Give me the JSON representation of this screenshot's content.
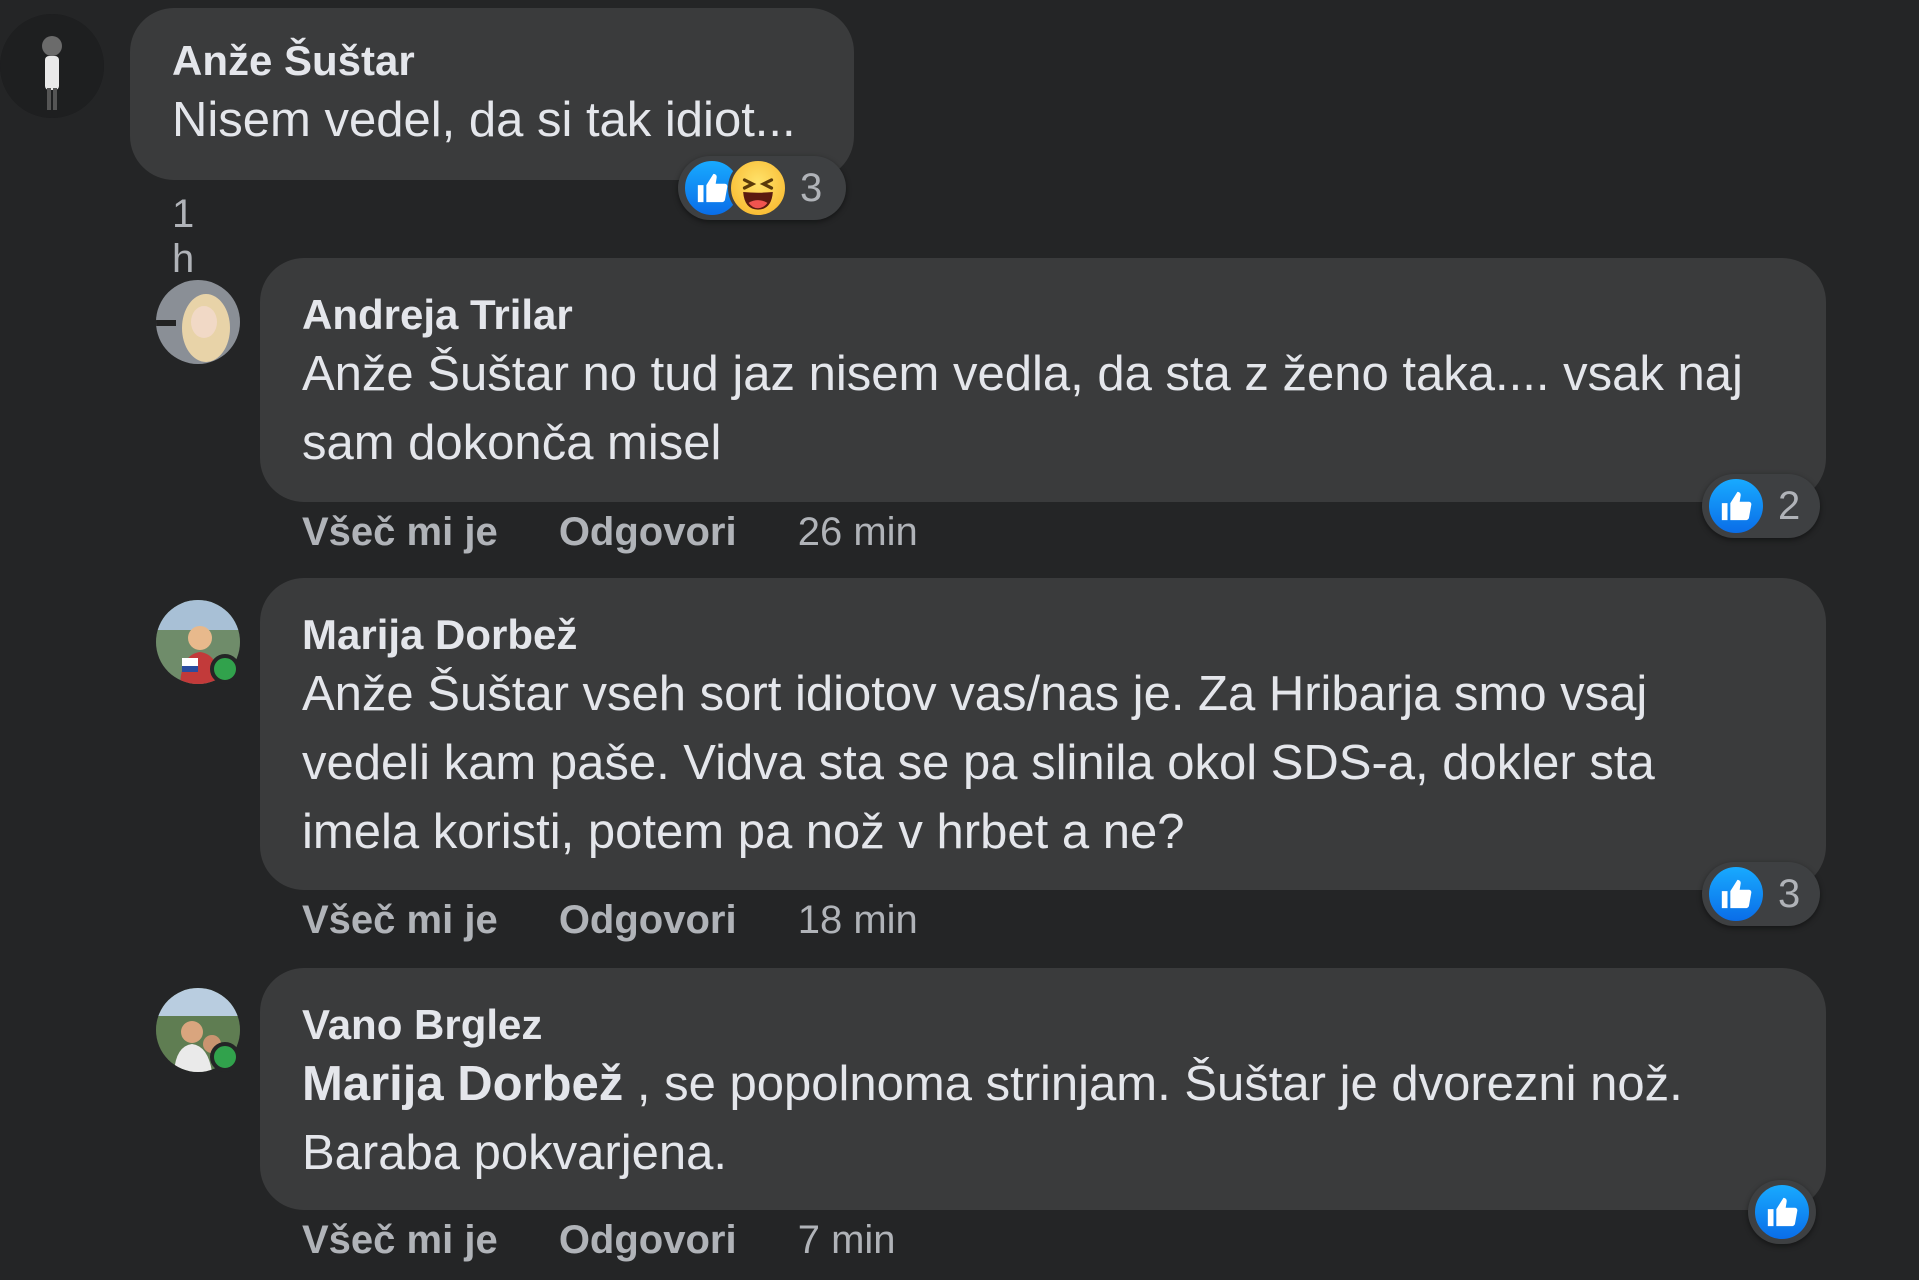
{
  "comments": [
    {
      "author": "Anže Šuštar",
      "text": "Nisem vedel, da si tak idiot...",
      "time": "1 h",
      "reactions": [
        "like",
        "haha"
      ],
      "reaction_count": "3"
    },
    {
      "author": "Andreja Trilar",
      "text": "Anže Šuštar no tud jaz nisem vedla, da sta z ženo taka.... vsak naj sam dokonča misel",
      "like_label": "Všeč mi je",
      "reply_label": "Odgovori",
      "time": "26 min",
      "reactions": [
        "like"
      ],
      "reaction_count": "2"
    },
    {
      "author": "Marija Dorbež",
      "text": "Anže Šuštar vseh sort idiotov vas/nas je. Za Hribarja smo vsaj vedeli kam paše. Vidva sta se pa slinila okol SDS-a, dokler sta imela koristi, potem pa nož v hrbet a ne?",
      "like_label": "Všeč mi je",
      "reply_label": "Odgovori",
      "time": "18 min",
      "reactions": [
        "like"
      ],
      "reaction_count": "3",
      "online": true
    },
    {
      "author": "Vano Brglez",
      "mention": "Marija Dorbež",
      "text": " , se popolnoma strinjam. Šuštar je dvorezni nož. Baraba pokvarjena.",
      "like_label": "Všeč mi je",
      "reply_label": "Odgovori",
      "time": "7 min",
      "reactions": [
        "like"
      ],
      "reaction_count": "",
      "online": true
    }
  ],
  "colors": {
    "background": "#242526",
    "bubble": "#3a3b3c",
    "text": "#e4e6eb",
    "secondary_text": "#b0b3b8",
    "like_blue": "#0a6de8",
    "online_green": "#31a24c"
  }
}
